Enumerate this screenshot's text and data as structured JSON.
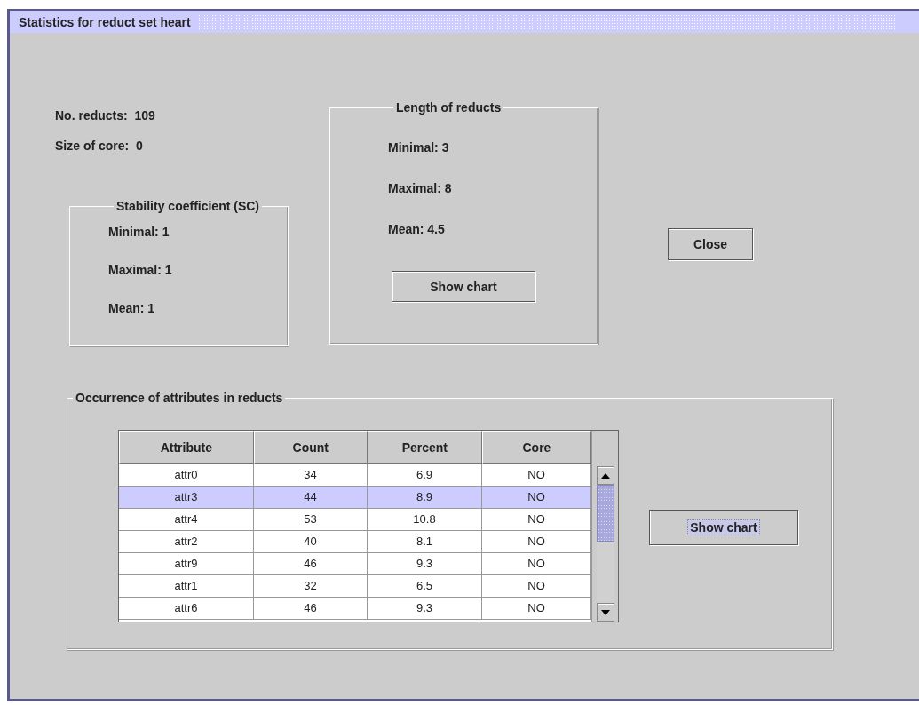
{
  "window": {
    "title": "Statistics for reduct set heart"
  },
  "summary": [
    {
      "label": "No. reducts:",
      "value": "109"
    },
    {
      "label": "Size of core:",
      "value": "0"
    }
  ],
  "stability": {
    "title": "Stability coefficient (SC)",
    "items": [
      "Minimal: 1",
      "Maximal: 1",
      "Mean: 1"
    ]
  },
  "length": {
    "title": "Length of reducts",
    "items": [
      "Minimal: 3",
      "Maximal: 8",
      "Mean: 4.5"
    ],
    "button": {
      "label": "Show chart",
      "focused": false
    }
  },
  "close_button": {
    "label": "Close",
    "focused": false
  },
  "occurrence": {
    "title": "Occurrence of attributes in reducts",
    "table": {
      "columns": [
        "Attribute",
        "Count",
        "Percent",
        "Core"
      ],
      "rows": [
        {
          "cells": [
            "attr0",
            "34",
            "6.9",
            "NO"
          ],
          "selected": false
        },
        {
          "cells": [
            "attr3",
            "44",
            "8.9",
            "NO"
          ],
          "selected": true
        },
        {
          "cells": [
            "attr4",
            "53",
            "10.8",
            "NO"
          ],
          "selected": false
        },
        {
          "cells": [
            "attr2",
            "40",
            "8.1",
            "NO"
          ],
          "selected": false
        },
        {
          "cells": [
            "attr9",
            "46",
            "9.3",
            "NO"
          ],
          "selected": false
        },
        {
          "cells": [
            "attr1",
            "32",
            "6.5",
            "NO"
          ],
          "selected": false
        },
        {
          "cells": [
            "attr6",
            "46",
            "9.3",
            "NO"
          ],
          "selected": false
        }
      ]
    },
    "button": {
      "label": "Show chart",
      "focused": true
    }
  }
}
